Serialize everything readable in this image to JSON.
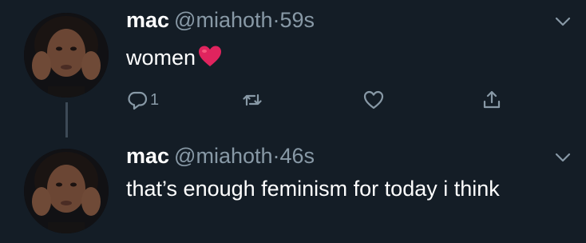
{
  "tweets": [
    {
      "name": "mac",
      "handle": "@miahoth",
      "separator": "·",
      "time": "59s",
      "text": "women",
      "reply_count": "1"
    },
    {
      "name": "mac",
      "handle": "@miahoth",
      "separator": "·",
      "time": "46s",
      "text": "that’s enough feminism for today i think"
    }
  ],
  "icons": {
    "reply": "reply-icon",
    "retweet": "retweet-icon",
    "like": "like-icon",
    "share": "share-icon",
    "more": "chevron-down-icon",
    "emoji": "red-heart-emoji"
  },
  "colors": {
    "background": "#141d26",
    "text": "#ffffff",
    "secondary": "#8899a6",
    "heart": "#e0245e"
  }
}
